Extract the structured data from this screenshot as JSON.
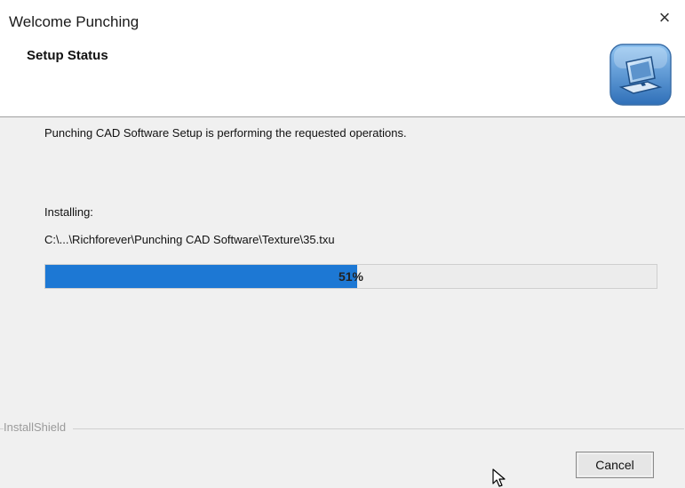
{
  "window": {
    "title": "Welcome Punching",
    "close_symbol": "×"
  },
  "header": {
    "title": "Setup Status",
    "icon": "computer-setup-icon"
  },
  "main": {
    "status_message": "Punching CAD Software Setup is performing the requested operations.",
    "installing_label": "Installing:",
    "current_file": "C:\\...\\Richforever\\Punching CAD Software\\Texture\\35.txu",
    "progress": {
      "percent": 51,
      "label": "51%",
      "fill_color": "#1d78d4"
    }
  },
  "footer": {
    "brand": "InstallShield",
    "cancel_label": "Cancel"
  },
  "cursor": {
    "icon": "mouse-pointer-icon"
  }
}
